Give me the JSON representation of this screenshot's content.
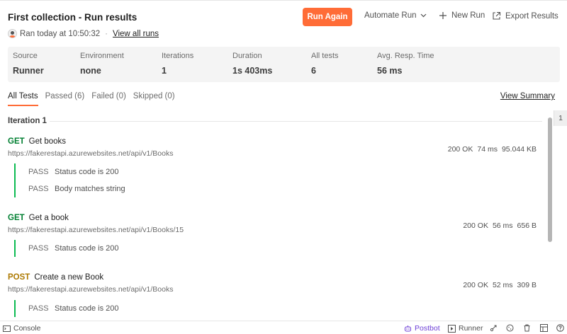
{
  "header": {
    "title": "First collection - Run results",
    "run_time": "Ran today at 10:50:32",
    "separator": "·",
    "view_all_runs": "View all runs"
  },
  "toolbar": {
    "run_again": "Run Again",
    "automate_run": "Automate Run",
    "new_run": "New Run",
    "export_results": "Export Results"
  },
  "stats": [
    {
      "label": "Source",
      "value": "Runner"
    },
    {
      "label": "Environment",
      "value": "none"
    },
    {
      "label": "Iterations",
      "value": "1"
    },
    {
      "label": "Duration",
      "value": "1s 403ms"
    },
    {
      "label": "All tests",
      "value": "6"
    },
    {
      "label": "Avg. Resp. Time",
      "value": "56 ms"
    }
  ],
  "tabs": [
    {
      "label": "All Tests",
      "active": true
    },
    {
      "label": "Passed (6)"
    },
    {
      "label": "Failed (0)"
    },
    {
      "label": "Skipped (0)"
    }
  ],
  "view_summary": "View Summary",
  "iteration_label": "Iteration 1",
  "side_badge": "1",
  "requests": [
    {
      "method": "GET",
      "name": "Get books",
      "url": "https://fakerestapi.azurewebsites.net/api/v1/Books",
      "status": "200 OK",
      "time": "74 ms",
      "size": "95.044 KB",
      "tests": [
        {
          "result": "PASS",
          "name": "Status code is 200"
        },
        {
          "result": "PASS",
          "name": "Body matches string"
        }
      ]
    },
    {
      "method": "GET",
      "name": "Get a book",
      "url": "https://fakerestapi.azurewebsites.net/api/v1/Books/15",
      "status": "200 OK",
      "time": "56 ms",
      "size": "656 B",
      "tests": [
        {
          "result": "PASS",
          "name": "Status code is 200"
        }
      ]
    },
    {
      "method": "POST",
      "name": "Create a new Book",
      "url": "https://fakerestapi.azurewebsites.net/api/v1/Books",
      "status": "200 OK",
      "time": "52 ms",
      "size": "309 B",
      "tests": [
        {
          "result": "PASS",
          "name": "Status code is 200"
        }
      ]
    }
  ],
  "footer": {
    "console": "Console",
    "postbot": "Postbot",
    "runner": "Runner"
  },
  "colors": {
    "accent": "#ff6c37",
    "pass_bar": "#0cbb52",
    "get": "#007f31",
    "post": "#ad7a03",
    "postbot": "#6d3fd6"
  },
  "icons": [
    "avatar-icon",
    "chevron-down-icon",
    "plus-icon",
    "export-icon",
    "console-icon",
    "postbot-icon",
    "runner-icon",
    "capture-icon",
    "cookie-icon",
    "trash-icon",
    "layout-icon",
    "help-icon"
  ]
}
